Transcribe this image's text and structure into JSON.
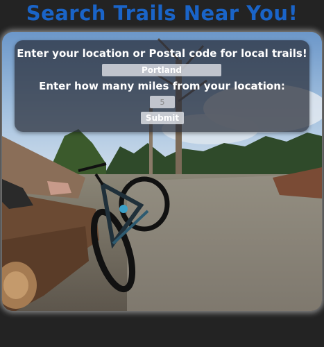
{
  "header": {
    "title": "Search Trails Near You!"
  },
  "form": {
    "location_label": "Enter your location or Postal code for local trails!",
    "location_value": "Portland",
    "miles_label": "Enter how many miles from your location:",
    "miles_value": "5",
    "submit_label": "Submit"
  },
  "colors": {
    "title": "#1a64c8",
    "background": "#232323"
  }
}
